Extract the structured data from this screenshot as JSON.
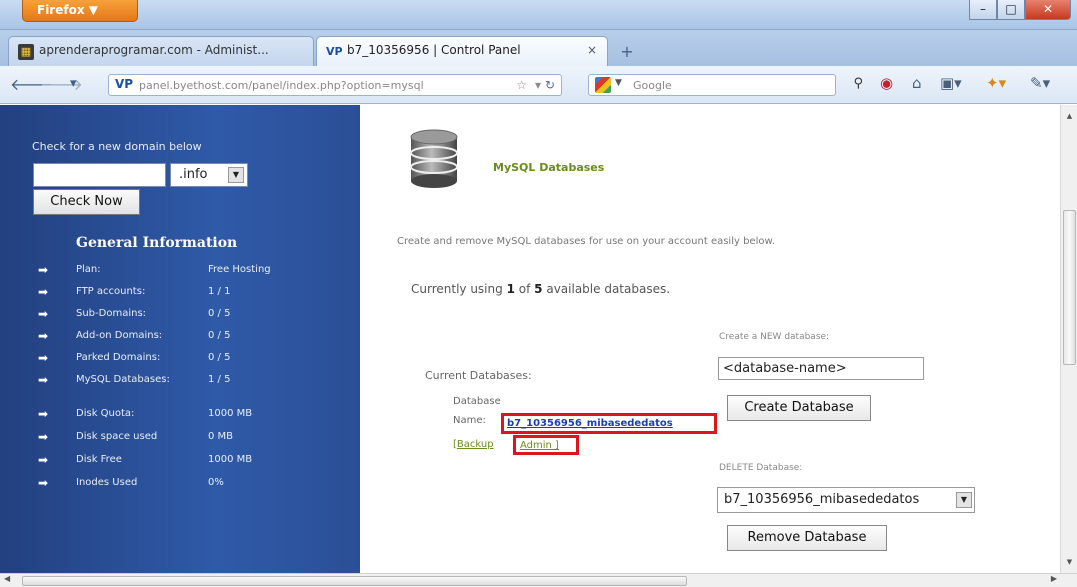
{
  "browser": {
    "menu_label": "Firefox ▼",
    "window_controls": {
      "minimize": "–",
      "maximize": "□",
      "close": "✕"
    },
    "tabs": [
      {
        "label": "aprenderaprogramar.com - Administ...",
        "active": false
      },
      {
        "label": "b7_10356956 | Control Panel",
        "active": true,
        "close": "×"
      }
    ],
    "new_tab": "+",
    "url": {
      "host": "panel.byethost.com",
      "path": "/panel/index.php?option=mysql",
      "badge": "VP"
    },
    "search": {
      "engine_arrow": "▼",
      "placeholder": "Google"
    }
  },
  "sidebar": {
    "check_label": "Check for a new domain below",
    "tld_value": ".info",
    "check_button": "Check Now",
    "general_title": "General Information",
    "rows": [
      {
        "label": "Plan:",
        "value": "Free Hosting"
      },
      {
        "label": "FTP accounts:",
        "value": "1 / 1"
      },
      {
        "label": "Sub-Domains:",
        "value": "0 / 5"
      },
      {
        "label": "Add-on Domains:",
        "value": "0 / 5"
      },
      {
        "label": "Parked Domains:",
        "value": "0 / 5"
      },
      {
        "label": "MySQL Databases:",
        "value": "1 / 5"
      },
      {
        "label": "Disk Quota:",
        "value": "1000 MB"
      },
      {
        "label": "Disk space used",
        "value": "0 MB"
      },
      {
        "label": "Disk Free",
        "value": "1000 MB"
      },
      {
        "label": "Inodes Used",
        "value": "0%"
      }
    ]
  },
  "main": {
    "title": "MySQL Databases",
    "intro": "Create and remove MySQL databases for use on your account easily below.",
    "usage": {
      "prefix": "Currently using",
      "used": "1",
      "middle": "of",
      "total": "5",
      "suffix": "available databases."
    },
    "create_label": "Create a NEW database:",
    "dbname_value": "<database-name>",
    "create_button": "Create Database",
    "current_label": "Current Databases:",
    "db_label": "Database",
    "name_label": "Name:",
    "db_name": "b7_10356956_mibasededatos",
    "backup_open": "[",
    "backup_link": "Backup",
    "admin_link": "Admin ]",
    "delete_label": "DELETE Database:",
    "delete_value": "b7_10356956_mibasededatos",
    "remove_button": "Remove Database"
  },
  "colors": {
    "sidebar_bg": "#2b4f96",
    "highlight_border": "#e0141c",
    "title_green": "#6a8d1a",
    "link_blue": "#1a3fb0"
  }
}
